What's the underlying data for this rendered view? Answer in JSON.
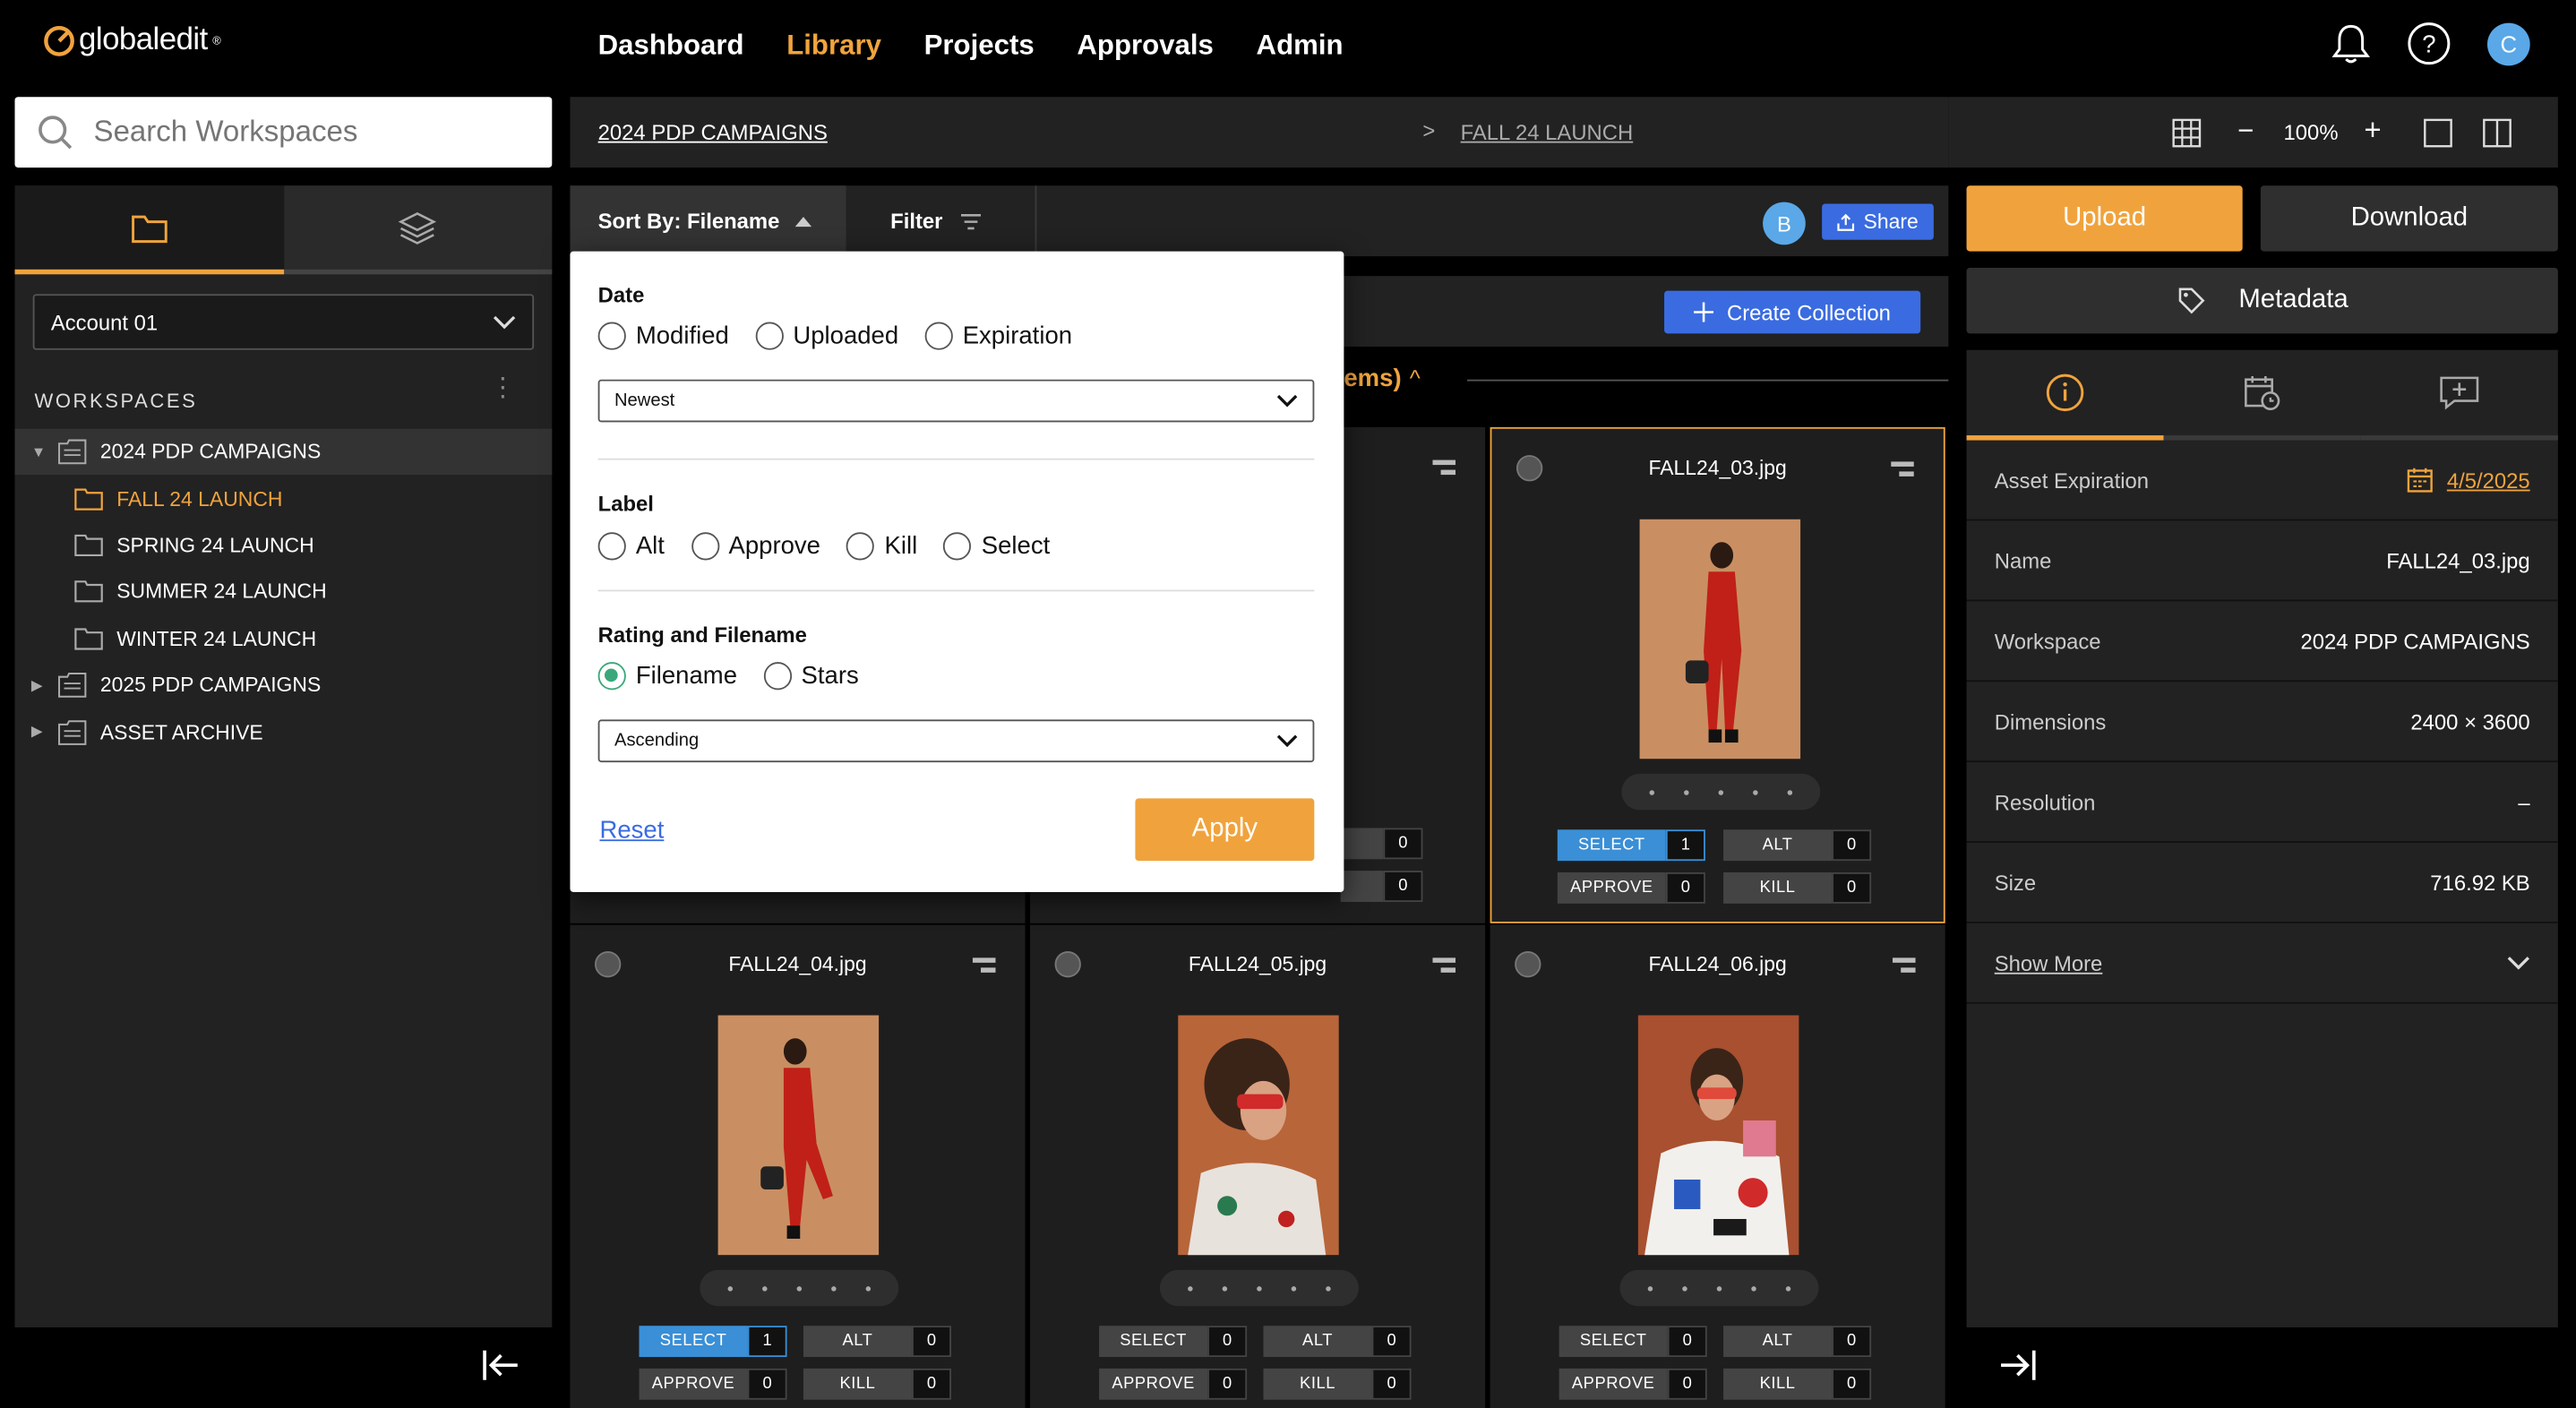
{
  "app": {
    "logo_text": "globaledit",
    "logo_mark": "®"
  },
  "nav": {
    "items": [
      "Dashboard",
      "Library",
      "Projects",
      "Approvals",
      "Admin"
    ],
    "active": "Library"
  },
  "user": {
    "initial": "C"
  },
  "search": {
    "placeholder": "Search Workspaces"
  },
  "sidebar": {
    "account": "Account 01",
    "workspaces_title": "WORKSPACES",
    "tree": [
      {
        "label": "2024 PDP CAMPAIGNS",
        "children": [
          "FALL 24 LAUNCH",
          "SPRING 24 LAUNCH",
          "SUMMER 24 LAUNCH",
          "WINTER 24 LAUNCH"
        ]
      },
      {
        "label": "2025 PDP CAMPAIGNS"
      },
      {
        "label": "ASSET ARCHIVE"
      }
    ],
    "current": "FALL 24 LAUNCH"
  },
  "breadcrumb": {
    "workspace": "2024 PDP CAMPAIGNS",
    "sep": ">",
    "folder": "FALL 24 LAUNCH"
  },
  "view": {
    "zoom": "100%",
    "zoom_out": "−",
    "zoom_in": "+"
  },
  "toolbar": {
    "sort_label": "Sort By: Filename",
    "filter_label": "Filter",
    "collab_initial": "B",
    "share_label": "Share"
  },
  "collection": {
    "create_label": "Create Collection",
    "items_label": "ems)",
    "items_caret": "^"
  },
  "sort_panel": {
    "date_heading": "Date",
    "date_options": [
      "Modified",
      "Uploaded",
      "Expiration"
    ],
    "date_order": "Newest",
    "label_heading": "Label",
    "label_options": [
      "Alt",
      "Approve",
      "Kill",
      "Select"
    ],
    "rating_heading": "Rating and Filename",
    "rating_options": [
      "Filename",
      "Stars"
    ],
    "rating_selected": "Filename",
    "rating_order": "Ascending",
    "reset_label": "Reset",
    "apply_label": "Apply"
  },
  "assets": [
    {
      "name": "FALL24_03.jpg",
      "select": "1",
      "alt": "0",
      "approve": "0",
      "kill": "0",
      "highlight": true,
      "photo": "red-suit-standing",
      "select_on": true
    },
    {
      "name": "FALL24_04.jpg",
      "select": "1",
      "alt": "0",
      "approve": "0",
      "kill": "0",
      "photo": "red-suit-pose",
      "select_on": true
    },
    {
      "name": "FALL24_05.jpg",
      "select": "0",
      "alt": "0",
      "approve": "0",
      "kill": "0",
      "photo": "sunglasses-portrait"
    },
    {
      "name": "FALL24_06.jpg",
      "select": "0",
      "alt": "0",
      "approve": "0",
      "kill": "0",
      "photo": "sweater-portrait"
    }
  ],
  "hidden_card_counts": {
    "alt": "0",
    "kill": "0"
  },
  "pill_labels": {
    "select": "SELECT",
    "alt": "ALT",
    "approve": "APPROVE",
    "kill": "KILL"
  },
  "actions": {
    "upload": "Upload",
    "download": "Download",
    "metadata": "Metadata"
  },
  "details": {
    "asset_expiration_label": "Asset Expiration",
    "asset_expiration": "4/5/2025",
    "name_label": "Name",
    "name": "FALL24_03.jpg",
    "workspace_label": "Workspace",
    "workspace": "2024 PDP CAMPAIGNS",
    "dimensions_label": "Dimensions",
    "dimensions": "2400 × 3600",
    "resolution_label": "Resolution",
    "resolution": "–",
    "size_label": "Size",
    "size": "716.92 KB",
    "show_more": "Show More"
  },
  "colors": {
    "accent": "#f0a33d",
    "blue": "#3a6be0",
    "select_blue": "#3a8fd6"
  }
}
